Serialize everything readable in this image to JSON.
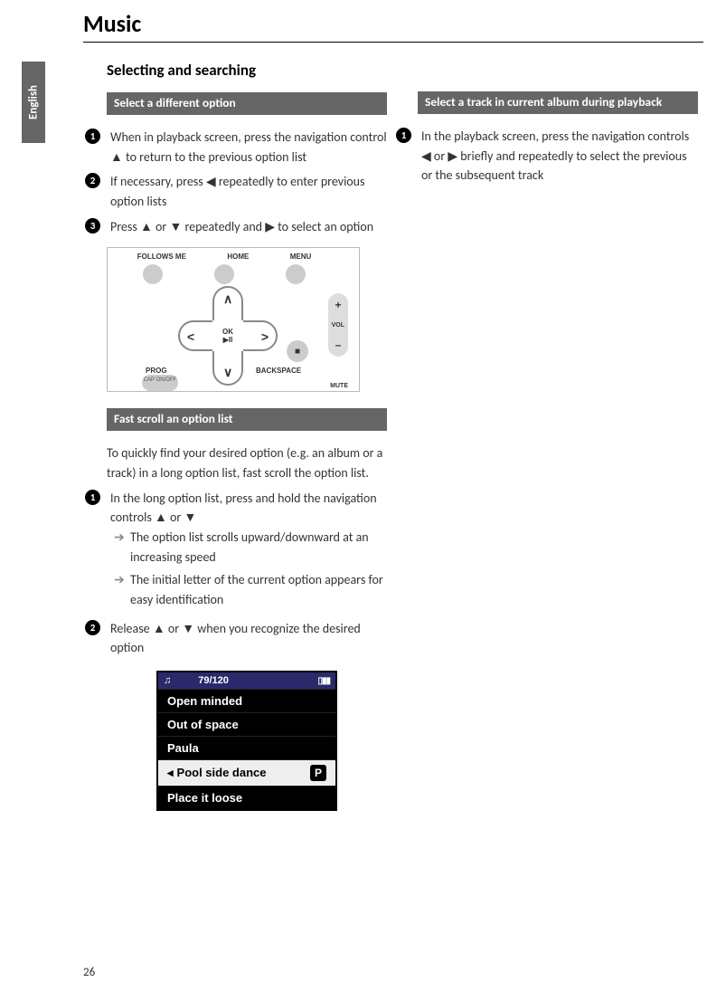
{
  "chapter": "Music",
  "language_tab": "English",
  "section_title": "Selecting and searching",
  "page_number": "26",
  "left": {
    "heading1": "Select a different option",
    "step1": "When in playback screen, press the navigation control ▲ to return to the previous option list",
    "step2": "If necessary, press ◀ repeatedly to enter previous option lists",
    "step3": "Press ▲ or ▼ repeatedly and ▶ to select an option",
    "heading2": "Fast scroll an option list",
    "intro2": "To quickly find your desired option (e.g. an album or a track) in a long option list, fast scroll the option list.",
    "step2_1": "In the long option list, press and hold the navigation controls ▲ or ▼",
    "sub2_1a": "The option list scrolls upward/downward at an increasing speed",
    "sub2_1b": "The initial letter of the current option appears for easy identification",
    "step2_2": "Release ▲ or ▼ when you recognize the desired option"
  },
  "right": {
    "heading1": "Select a track in current album during playback",
    "step1": "In the playback screen, press the navigation controls ◀ or ▶ briefly and repeatedly to select the previous or the subsequent track"
  },
  "remote": {
    "top_labels": [
      "FOLLOWS ME",
      "HOME",
      "MENU"
    ],
    "center_top": "OK",
    "center_bottom": "▶II",
    "prog": "PROG",
    "backspace": "BACKSPACE",
    "cap": "CAP ON/OFF",
    "vol": "VOL",
    "mute": "MUTE"
  },
  "screen": {
    "counter": "79/120",
    "rows": [
      "Open minded",
      "Out of space",
      "Paula"
    ],
    "selected": "Pool side dance",
    "selected_badge": "P",
    "last": "Place it loose"
  }
}
